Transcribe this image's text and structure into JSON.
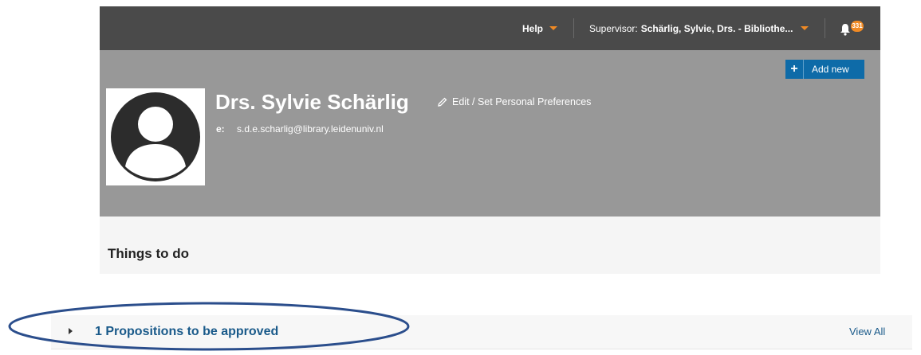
{
  "topbar": {
    "help_label": "Help",
    "supervisor_prefix": "Supervisor:",
    "supervisor_name": "Schärlig, Sylvie, Drs. - Bibliothe...",
    "notification_count": "331",
    "accent_color": "#f08a24"
  },
  "profile": {
    "name": "Drs. Sylvie Schärlig",
    "edit_label": "Edit / Set Personal Preferences",
    "email_label": "e:",
    "email": "s.d.e.scharlig@library.leidenuniv.nl",
    "add_new_label": "Add new",
    "avatar_icon": "user-avatar-icon"
  },
  "todo": {
    "title": "Things to do",
    "tasks": [
      {
        "label": "1 Propositions to be approved",
        "view_all": "View All"
      }
    ]
  },
  "colors": {
    "topbar_bg": "#4a4a4a",
    "profile_bg": "#989898",
    "button_blue": "#0e6ba8",
    "link_blue": "#1a5a8a",
    "annotation": "#2b4e8c"
  }
}
